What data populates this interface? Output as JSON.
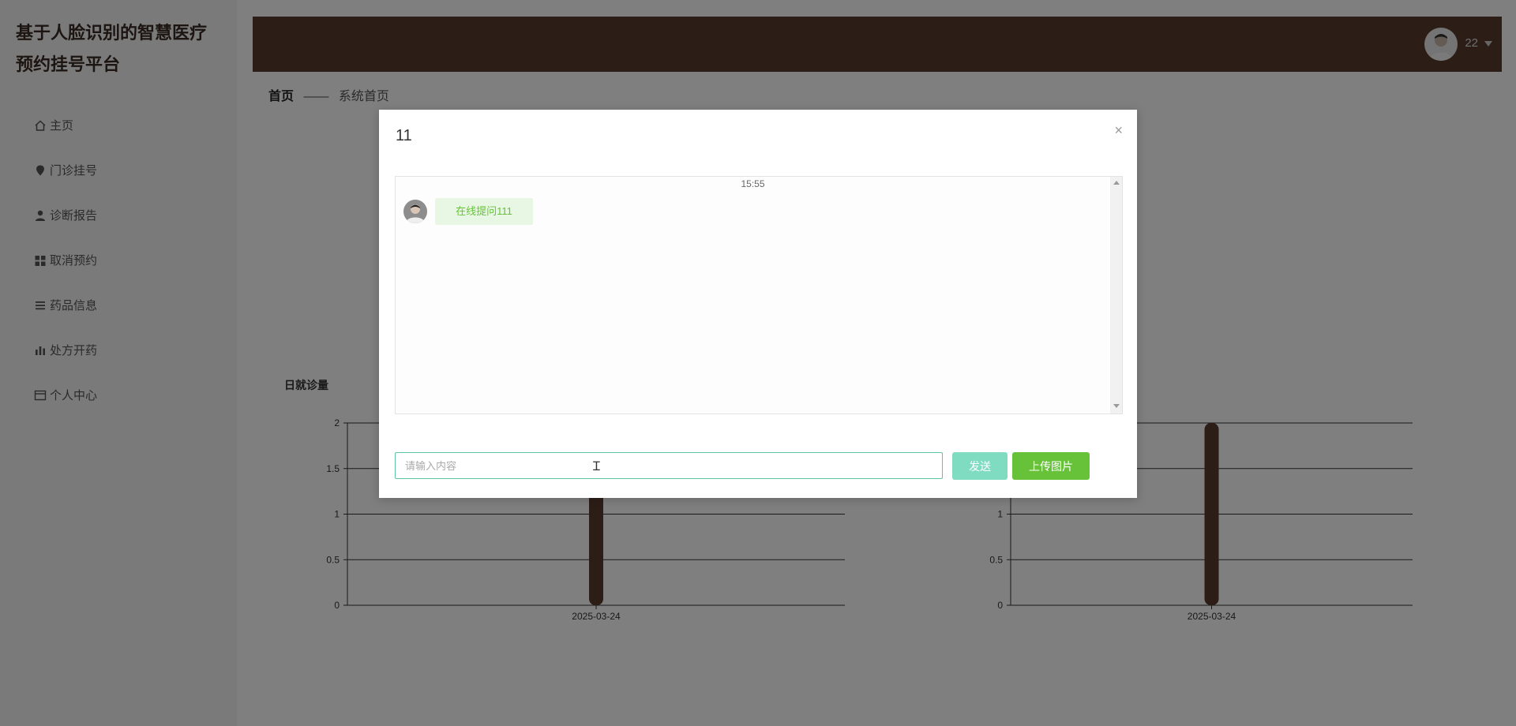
{
  "brand": {
    "line1": "基于人脸识别的智慧医疗",
    "line2": "预约挂号平台"
  },
  "sidebar": {
    "items": [
      {
        "label": "主页",
        "icon": "home-icon"
      },
      {
        "label": "门诊挂号",
        "icon": "location-pin-icon"
      },
      {
        "label": "诊断报告",
        "icon": "user-icon"
      },
      {
        "label": "取消预约",
        "icon": "grid-icon"
      },
      {
        "label": "药品信息",
        "icon": "list-icon"
      },
      {
        "label": "处方开药",
        "icon": "bar-chart-icon"
      },
      {
        "label": "个人中心",
        "icon": "card-icon"
      }
    ]
  },
  "header": {
    "user_name": "22",
    "accent": "#5b3b2e"
  },
  "breadcrumb": {
    "first": "首页",
    "sep": "——",
    "second": "系统首页"
  },
  "panels": [
    {
      "title": "日就诊量"
    },
    {
      "title": ""
    }
  ],
  "chart_data": [
    {
      "type": "bar",
      "title": "日就诊量",
      "categories": [
        "2025-03-24"
      ],
      "values": [
        2
      ],
      "ylim": [
        0,
        2
      ],
      "yticks": [
        "0",
        "0.5",
        "1",
        "1.5",
        "2"
      ],
      "xlabel": "",
      "ylabel": "",
      "bar_color": "#5b3b2e",
      "grid": true
    },
    {
      "type": "bar",
      "title": "",
      "categories": [
        "2025-03-24"
      ],
      "values": [
        2
      ],
      "ylim": [
        0,
        2
      ],
      "yticks": [
        "0",
        "0.5",
        "1",
        "1.5",
        "2"
      ],
      "xlabel": "",
      "ylabel": "",
      "bar_color": "#5b3b2e",
      "grid": true
    }
  ],
  "modal": {
    "title": "11",
    "close": "×",
    "chat": {
      "time": "15:55",
      "messages": [
        {
          "text": "在线提问111"
        }
      ]
    },
    "input_placeholder": "请输入内容",
    "send_label": "发送",
    "upload_label": "上传图片"
  }
}
